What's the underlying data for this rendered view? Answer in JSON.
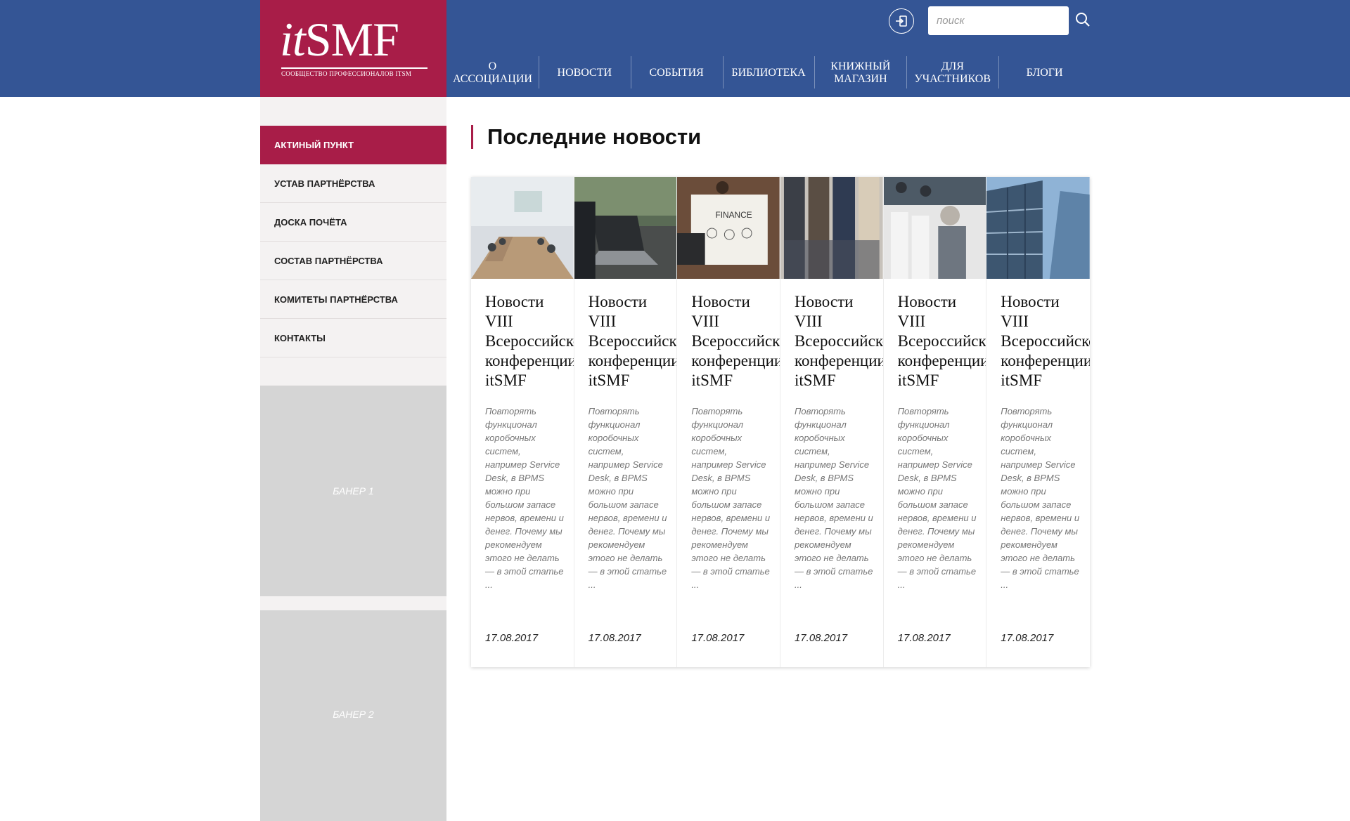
{
  "header": {
    "logo_text_it": "it",
    "logo_text_smf": "SMF",
    "logo_subtitle": "СООБЩЕСТВО ПРОФЕССИОНАЛОВ ITSM",
    "search_placeholder": "поиск",
    "nav": [
      {
        "line1": "О",
        "line2": "АССОЦИАЦИИ"
      },
      {
        "line1": "НОВОСТИ",
        "line2": ""
      },
      {
        "line1": "СОБЫТИЯ",
        "line2": ""
      },
      {
        "line1": "БИБЛИОТЕКА",
        "line2": ""
      },
      {
        "line1": "КНИЖНЫЙ",
        "line2": "МАГАЗИН"
      },
      {
        "line1": "ДЛЯ",
        "line2": "УЧАСТНИКОВ"
      },
      {
        "line1": "БЛОГИ",
        "line2": ""
      }
    ]
  },
  "sidebar": {
    "items": [
      {
        "label": "АКТИНЫЙ ПУНКТ"
      },
      {
        "label": "УСТАВ ПАРТНЁРСТВА"
      },
      {
        "label": "ДОСКА ПОЧЁТА"
      },
      {
        "label": "СОСТАВ ПАРТНЁРСТВА"
      },
      {
        "label": "КОМИТЕТЫ ПАРТНЁРСТВА"
      },
      {
        "label": "КОНТАКТЫ"
      }
    ],
    "banner1": "БАНЕР 1",
    "banner2": "БАНЕР 2"
  },
  "main": {
    "title": "Последние новости",
    "cards": [
      {
        "image": "meeting-room",
        "title_l1": "Новости",
        "title_l2": "VIII",
        "title_l3": "Всероссийской",
        "title_l4": "конференции",
        "title_l5": "itSMF",
        "text": "Повторять функционал коробочных систем, например Service Desk, в BPMS можно при большом запасе нервов, времени и денег. Почему мы рекомендуем этого не делать — в этой статье ...",
        "date": "17.08.2017"
      },
      {
        "image": "laptop",
        "title_l1": "Новости",
        "title_l2": "VIII",
        "title_l3": "Всероссийской",
        "title_l4": "конференции",
        "title_l5": "itSMF",
        "text": "Повторять функционал коробочных систем, например Service Desk, в BPMS можно при большом запасе нервов, времени и денег. Почему мы рекомендуем этого не делать — в этой статье ...",
        "date": "17.08.2017"
      },
      {
        "image": "finance",
        "title_l1": "Новости",
        "title_l2": "VIII",
        "title_l3": "Всероссийской",
        "title_l4": "конференции",
        "title_l5": "itSMF",
        "text": "Повторять функционал коробочных систем, например Service Desk, в BPMS можно при большом запасе нервов, времени и денег. Почему мы рекомендуем этого не делать — в этой статье ...",
        "date": "17.08.2017"
      },
      {
        "image": "people",
        "title_l1": "Новости",
        "title_l2": "VIII",
        "title_l3": "Всероссийской",
        "title_l4": "конференции",
        "title_l5": "itSMF",
        "text": "Повторять функционал коробочных систем, например Service Desk, в BPMS можно при большом запасе нервов, времени и денег. Почему мы рекомендуем этого не делать — в этой статье ...",
        "date": "17.08.2017"
      },
      {
        "image": "audience",
        "title_l1": "Новости",
        "title_l2": "VIII",
        "title_l3": "Всероссийской",
        "title_l4": "конференции",
        "title_l5": "itSMF",
        "text": "Повторять функционал коробочных систем, например Service Desk, в BPMS можно при большом запасе нервов, времени и денег. Почему мы рекомендуем этого не делать — в этой статье ...",
        "date": "17.08.2017"
      },
      {
        "image": "building",
        "title_l1": "Новости",
        "title_l2": "VIII",
        "title_l3": "Всероссийской",
        "title_l4": "конференции",
        "title_l5": "itSMF",
        "text": "Повторять функционал коробочных систем, например Service Desk, в BPMS можно при большом запасе нервов, времени и денег. Почему мы рекомендуем этого не делать — в этой статье ...",
        "date": "17.08.2017"
      }
    ]
  },
  "colors": {
    "header_blue": "#345595",
    "brand_crimson": "#a81d48",
    "sidebar_bg": "#f4f2f2",
    "banner_gray": "#d5d5d5"
  }
}
